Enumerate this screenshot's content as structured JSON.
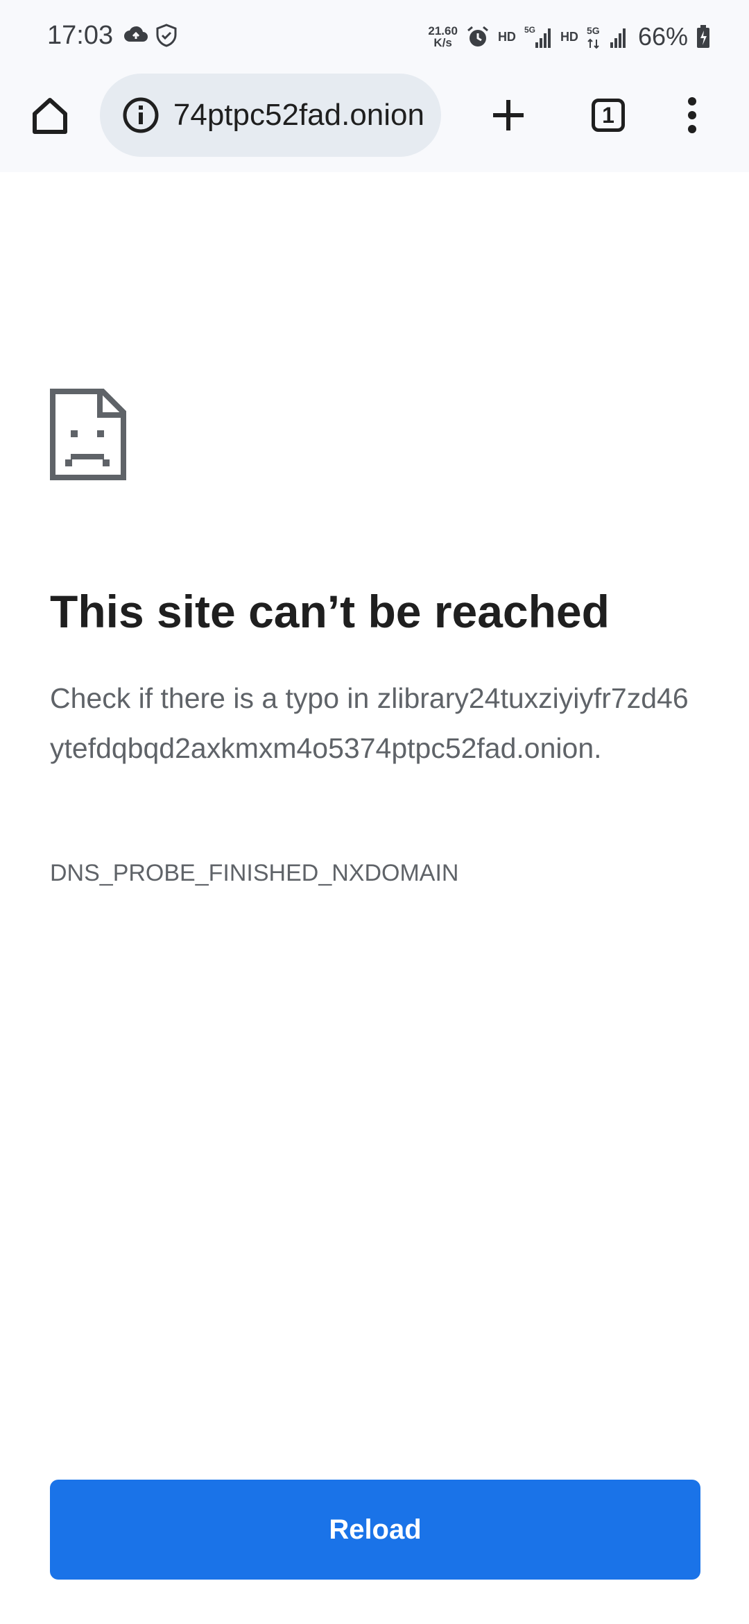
{
  "status_bar": {
    "time": "17:03",
    "net_speed_value": "21.60",
    "net_speed_unit": "K/s",
    "hd1": "HD",
    "hd2": "HD",
    "battery": "66%",
    "icons": [
      "cloud-upload-icon",
      "shield-check-icon",
      "alarm-icon",
      "signal-5g-icon",
      "signal-5g-data-icon",
      "battery-charging-icon"
    ]
  },
  "toolbar": {
    "url": "zlibrary24tuxziyiyfr7zd46ytefdqbqd2axkmxm4o5374ptpc52fad.onion",
    "tab_count": "1",
    "icons": [
      "home-icon",
      "info-icon",
      "plus-icon",
      "more-vert-icon"
    ]
  },
  "error_page": {
    "title": "This site can’t be reached",
    "description": "Check if there is a typo in zlibrary24tuxziyiyfr7zd46ytefdqbqd2axkmxm4o5374ptpc52fad.onion.",
    "error_code": "DNS_PROBE_FINISHED_NXDOMAIN",
    "reload_label": "Reload",
    "icon": "sad-page-icon"
  },
  "colors": {
    "accent": "#1a73e8",
    "text_primary": "#1f1f1f",
    "text_secondary": "#5f6368",
    "omnibox_bg": "#e6ebf1",
    "toolbar_bg": "#f8f9fc"
  }
}
